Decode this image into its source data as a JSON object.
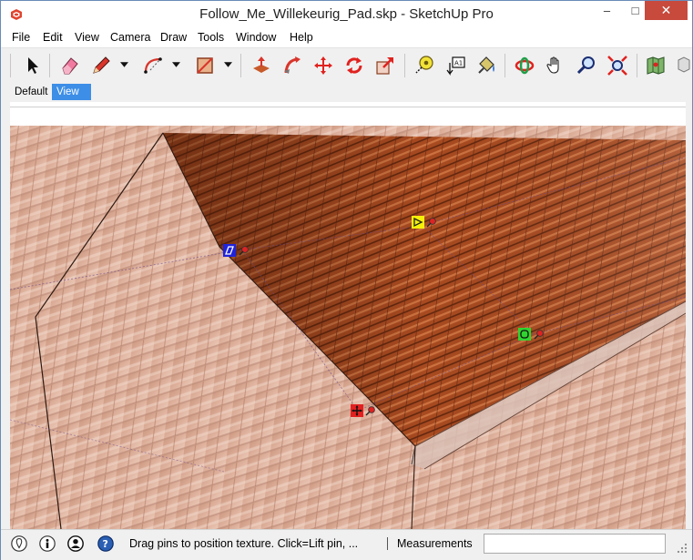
{
  "window": {
    "title": "Follow_Me_Willekeurig_Pad.skp - SketchUp Pro",
    "minimize": "–",
    "maximize": "□",
    "close": "✕"
  },
  "menu": {
    "items": [
      "File",
      "Edit",
      "View",
      "Camera",
      "Draw",
      "Tools",
      "Window",
      "Help"
    ]
  },
  "toolbar": {
    "tools": [
      "select-arrow-icon",
      "eraser-icon",
      "pencil-icon",
      "arc-icon",
      "rectangle-icon",
      "push-pull-icon",
      "follow-me-icon",
      "move-icon",
      "rotate-icon",
      "scale-icon",
      "tape-measure-icon",
      "text-label-icon",
      "paint-bucket-icon",
      "orbit-icon",
      "pan-hand-icon",
      "zoom-icon",
      "zoom-extents-icon",
      "map-icon",
      "component-icon"
    ]
  },
  "scenes": {
    "tabs": [
      "Default",
      "View"
    ],
    "active": "View"
  },
  "pins": {
    "move_pin": "move-pin-red",
    "scale_shear_pin": "scale-shear-pin-green",
    "distort_pin": "distort-pin-yellow",
    "skew_pin": "skew-pin-blue"
  },
  "status": {
    "hint": "Drag pins to position texture.  Click=Lift pin, ...",
    "measurements_label": "Measurements",
    "measurements_value": ""
  },
  "colors": {
    "titlebar_close": "#c74a3c",
    "active_tab": "#3d8ee6",
    "pin_red": "#e32020",
    "pin_green": "#31d331",
    "pin_yellow": "#f5f10a",
    "pin_blue": "#1f24d9"
  }
}
